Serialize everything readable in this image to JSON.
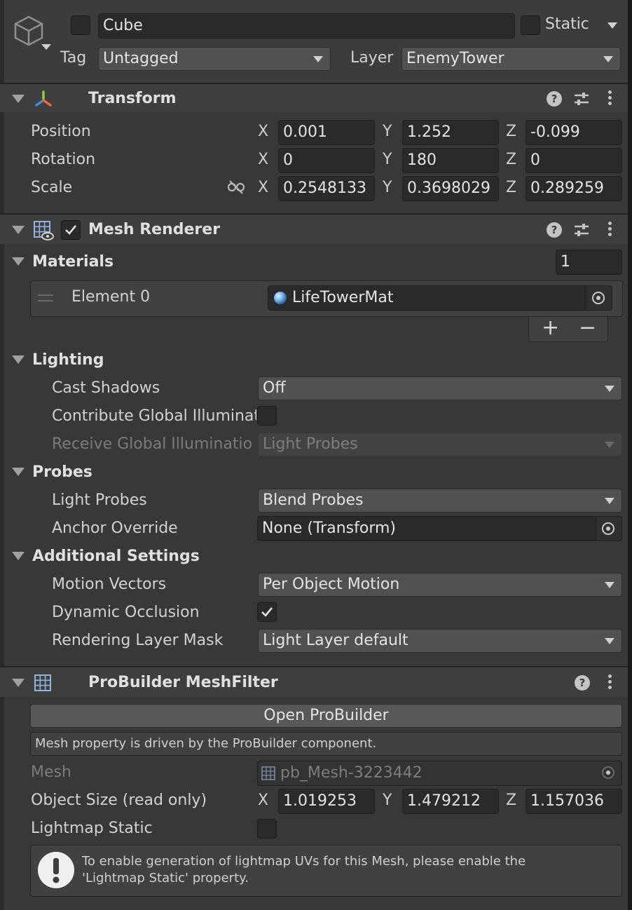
{
  "header": {
    "name": "Cube",
    "static_label": "Static",
    "tag_label": "Tag",
    "tag_value": "Untagged",
    "layer_label": "Layer",
    "layer_value": "EnemyTower"
  },
  "transform": {
    "title": "Transform",
    "position_label": "Position",
    "rotation_label": "Rotation",
    "scale_label": "Scale",
    "axes": [
      "X",
      "Y",
      "Z"
    ],
    "position": [
      "0.001",
      "1.252",
      "-0.099"
    ],
    "rotation": [
      "0",
      "180",
      "0"
    ],
    "scale": [
      "0.2548133",
      "0.3698029",
      "0.289259"
    ]
  },
  "mesh_renderer": {
    "title": "Mesh Renderer",
    "materials_label": "Materials",
    "materials_count": "1",
    "element_label": "Element 0",
    "element_value": "LifeTowerMat",
    "add": "+",
    "remove": "−",
    "lighting_label": "Lighting",
    "cast_shadows_label": "Cast Shadows",
    "cast_shadows_value": "Off",
    "contribute_gi_label": "Contribute Global Illuminat",
    "receive_gi_label": "Receive Global Illuminatio",
    "receive_gi_value": "Light Probes",
    "probes_label": "Probes",
    "light_probes_label": "Light Probes",
    "light_probes_value": "Blend Probes",
    "anchor_override_label": "Anchor Override",
    "anchor_override_value": "None (Transform)",
    "additional_label": "Additional Settings",
    "motion_vectors_label": "Motion Vectors",
    "motion_vectors_value": "Per Object Motion",
    "dynamic_occlusion_label": "Dynamic Occlusion",
    "rendering_layer_label": "Rendering Layer Mask",
    "rendering_layer_value": "Light Layer default"
  },
  "probuilder": {
    "title": "ProBuilder MeshFilter",
    "open_button": "Open ProBuilder",
    "info": "Mesh property is driven by the ProBuilder component.",
    "mesh_label": "Mesh",
    "mesh_value": "pb_Mesh-3223442",
    "size_label": "Object Size (read only)",
    "size": [
      "1.019253",
      "1.479212",
      "1.157036"
    ],
    "lightmap_static_label": "Lightmap Static",
    "warning_line1": "To enable generation of lightmap UVs for this Mesh, please enable the",
    "warning_line2": "'Lightmap Static' property."
  }
}
